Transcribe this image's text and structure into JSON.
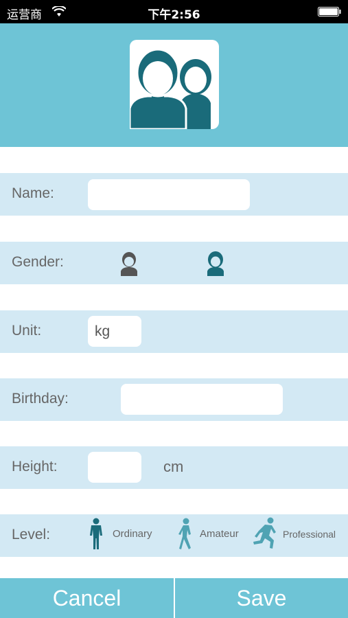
{
  "status_bar": {
    "carrier": "运营商",
    "time": "下午2:56"
  },
  "form": {
    "name": {
      "label": "Name:",
      "value": ""
    },
    "gender": {
      "label": "Gender:",
      "options": [
        "male-icon",
        "female-icon"
      ]
    },
    "unit": {
      "label": "Unit:",
      "value": "kg"
    },
    "birthday": {
      "label": "Birthday:",
      "value": ""
    },
    "height": {
      "label": "Height:",
      "value": "",
      "unit": "cm"
    },
    "level": {
      "label": "Level:",
      "options": [
        "Ordinary",
        "Amateur",
        "Professional"
      ]
    }
  },
  "footer": {
    "cancel": "Cancel",
    "save": "Save"
  },
  "colors": {
    "accent": "#6ec4d6",
    "row": "#d3e9f4",
    "icon_dark": "#1a6b7a",
    "icon_light": "#4fa3b3"
  }
}
